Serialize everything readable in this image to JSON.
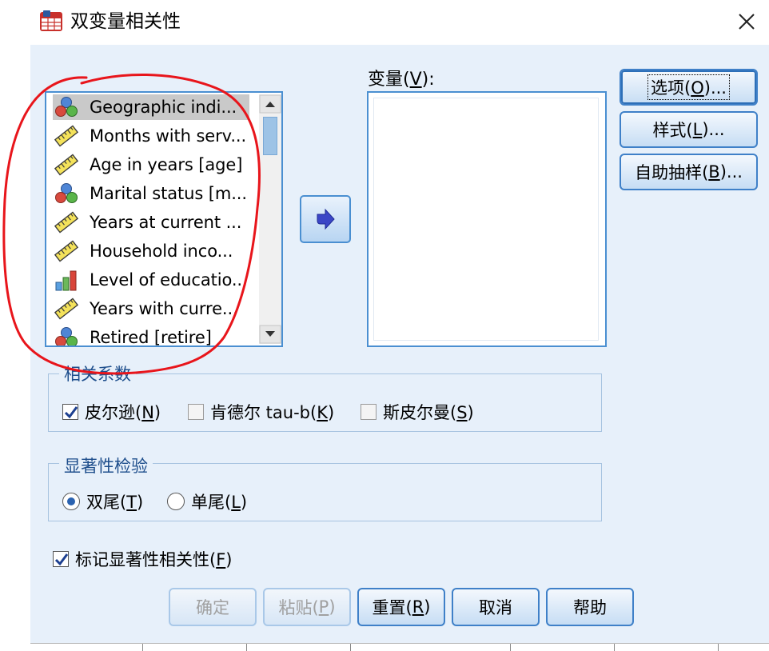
{
  "window": {
    "title": "双变量相关性",
    "close_glyph": "✕"
  },
  "source_list": {
    "items": [
      {
        "label": "Geographic indi...",
        "icon": "nominal-icon",
        "selected": true
      },
      {
        "label": "Months with serv...",
        "icon": "scale-icon"
      },
      {
        "label": "Age in years [age]",
        "icon": "scale-icon"
      },
      {
        "label": "Marital status [m...",
        "icon": "nominal-icon"
      },
      {
        "label": "Years at current ...",
        "icon": "scale-icon"
      },
      {
        "label": "Household inco...",
        "icon": "scale-icon"
      },
      {
        "label": "Level of educatio...",
        "icon": "ordinal-icon"
      },
      {
        "label": "Years with curre...",
        "icon": "scale-icon"
      },
      {
        "label": "Retired [retire]",
        "icon": "nominal-icon"
      }
    ]
  },
  "variables": {
    "label_pre": "变量(",
    "mnemonic": "V",
    "label_post": "):"
  },
  "side_buttons": {
    "options": {
      "pre": "选项(",
      "key": "O",
      "post": ")..."
    },
    "style": {
      "pre": "样式(",
      "key": "L",
      "post": ")..."
    },
    "bootstrap": {
      "pre": "自助抽样(",
      "key": "B",
      "post": ")..."
    }
  },
  "coefficients": {
    "title": "相关系数",
    "pearson": {
      "pre": "皮尔逊(",
      "key": "N",
      "post": ")",
      "checked": true
    },
    "kendall": {
      "pre": "肯德尔 tau-b(",
      "key": "K",
      "post": ")",
      "checked": false
    },
    "spearman": {
      "pre": "斯皮尔曼(",
      "key": "S",
      "post": ")",
      "checked": false
    }
  },
  "significance": {
    "title": "显著性检验",
    "two_tailed": {
      "pre": "双尾(",
      "key": "T",
      "post": ")",
      "selected": true
    },
    "one_tailed": {
      "pre": "单尾(",
      "key": "L",
      "post": ")",
      "selected": false
    }
  },
  "flag_significant": {
    "pre": "标记显著性相关性(",
    "key": "F",
    "post": ")",
    "checked": true
  },
  "bottom_buttons": {
    "ok": {
      "label": "确定",
      "enabled": false
    },
    "paste": {
      "pre": "粘贴(",
      "key": "P",
      "post": ")",
      "enabled": false
    },
    "reset": {
      "pre": "重置(",
      "key": "R",
      "post": ")"
    },
    "cancel": {
      "label": "取消"
    },
    "help": {
      "label": "帮助"
    }
  },
  "colors": {
    "accent": "#3f80c8",
    "panel": "#e7f0fa",
    "annotation": "#e8151b"
  }
}
